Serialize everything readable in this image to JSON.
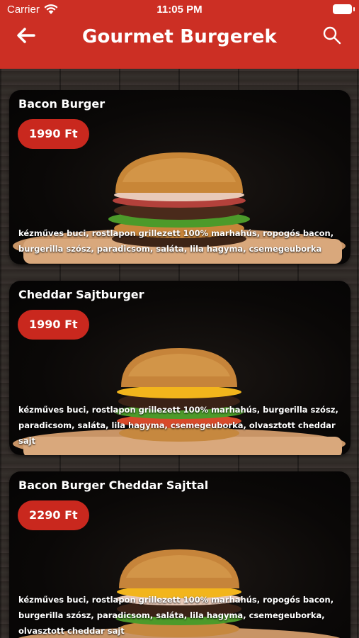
{
  "status_bar": {
    "carrier": "Carrier",
    "time": "11:05 PM"
  },
  "header": {
    "title": "Gourmet Burgerek",
    "back_icon": "arrow-left-icon",
    "search_icon": "search-icon"
  },
  "colors": {
    "header": "#cc2f24",
    "price_badge": "#c9281e"
  },
  "products": [
    {
      "name": "Bacon Burger",
      "price": "1990 Ft",
      "description": "kézműves buci, rostlapon grillezett 100% marhahús, ropogós bacon, burgerilla szósz, paradicsom, saláta, lila hagyma, csemegeuborka"
    },
    {
      "name": "Cheddar Sajtburger",
      "price": "1990 Ft",
      "description": "kézműves buci, rostlapon grillezett 100% marhahús, burgerilla szósz, paradicsom, saláta, lila hagyma, csemegeuborka, olvasztott cheddar sajt"
    },
    {
      "name": "Bacon Burger Cheddar Sajttal",
      "price": "2290 Ft",
      "description": "kézműves buci, rostlapon grillezett 100% marhahús, ropogós bacon, burgerilla szósz, paradicsom, saláta, lila hagyma, csemegeuborka, olvasztott cheddar sajt"
    }
  ]
}
